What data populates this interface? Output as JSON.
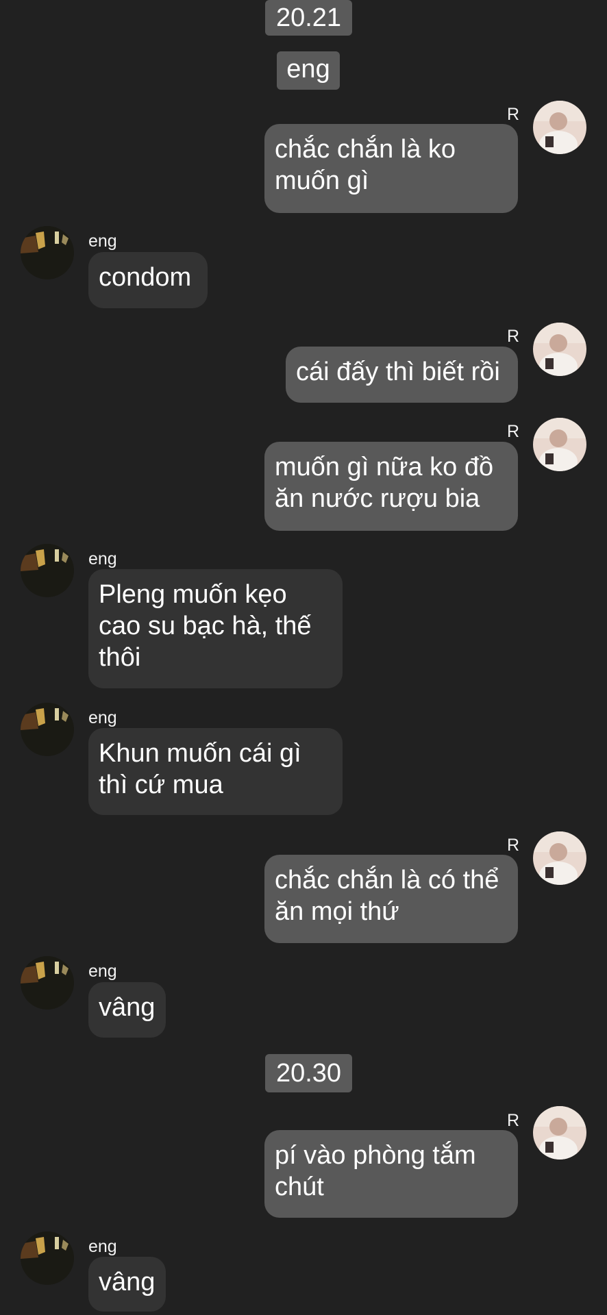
{
  "conversation": {
    "time_chips": [
      "20.21",
      "20.30"
    ],
    "subtitle": "eng",
    "self_name": "R",
    "contact_name": "eng",
    "messages": [
      {
        "sender": "R",
        "text": "chắc chắn là ko\nmuốn gì"
      },
      {
        "sender": "eng",
        "text": "condom"
      },
      {
        "sender": "R",
        "text": "cái đấy thì biết rồi"
      },
      {
        "sender": "R",
        "text": "muốn gì nữa ko đồ\năn nước rượu bia"
      },
      {
        "sender": "eng",
        "text": "Pleng muốn kẹo\ncao su bạc hà, thế\nthôi"
      },
      {
        "sender": "eng",
        "text": "Khun muốn cái gì\nthì cứ mua"
      },
      {
        "sender": "R",
        "text": "chắc chắn là có thể\năn mọi thứ"
      },
      {
        "sender": "eng",
        "text": "vâng"
      },
      {
        "sender": "R",
        "text": "pí vào phòng tắm\nchút"
      },
      {
        "sender": "eng",
        "text": "vâng"
      }
    ]
  },
  "colors": {
    "background": "#212121",
    "incoming_bubble": "#333333",
    "outgoing_bubble": "#595959",
    "time_chip": "#5a5a5a"
  },
  "icons": {
    "self_avatar": "user-photo-avatar",
    "contact_avatar": "contact-photo-avatar"
  }
}
